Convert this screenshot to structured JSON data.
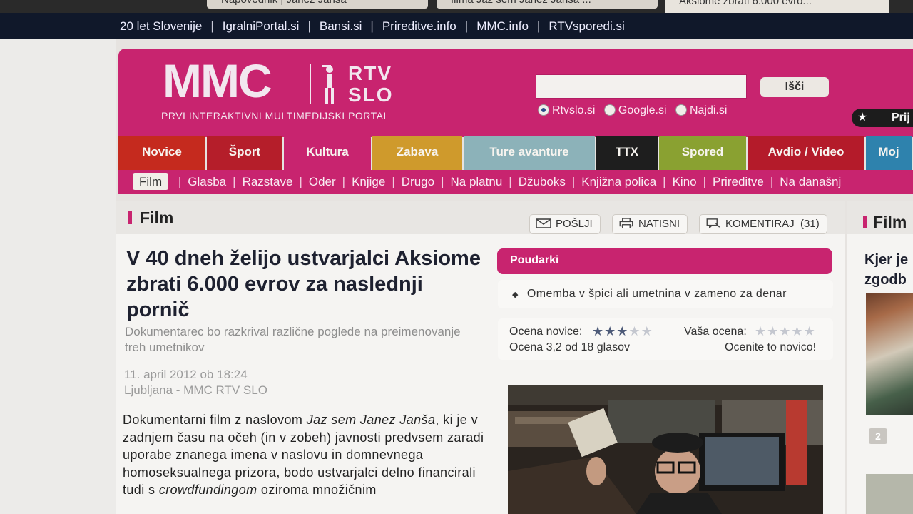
{
  "browser_tabs": [
    "Napovednik | Janez Janša",
    "filma Jaz sem Janez Janša ...",
    "Aksiome zbrati 6.000 evro..."
  ],
  "top_links": [
    "20 let Slovenije",
    "IgralniPortal.si",
    "Bansi.si",
    "Prireditve.info",
    "MMC.info",
    "RTVsporedi.si"
  ],
  "logo": {
    "mmc": "MMC",
    "rtv": "RTV",
    "slo": "SLO",
    "tagline": "PRVI INTERAKTIVNI MULTIMEDIJSKI PORTAL"
  },
  "search": {
    "value": "",
    "button": "Išči",
    "options": [
      "Rtvslo.si",
      "Google.si",
      "Najdi.si"
    ],
    "selected": "Rtvslo.si"
  },
  "login": {
    "label": "Prij"
  },
  "nav": [
    {
      "label": "Novice",
      "color": "#c52a1e"
    },
    {
      "label": "Šport",
      "color": "#b51e2a"
    },
    {
      "label": "Kultura",
      "color": "#c8246f"
    },
    {
      "label": "Zabava",
      "color": "#cf9a2c"
    },
    {
      "label": "Ture avanture",
      "color": "#8cb2b9"
    },
    {
      "label": "TTX",
      "color": "#1e1e1e"
    },
    {
      "label": "Spored",
      "color": "#8aa131"
    },
    {
      "label": "Avdio / Video",
      "color": "#b41b2a"
    },
    {
      "label": "Moj",
      "color": "#2e82ad"
    }
  ],
  "subnav": {
    "active": "Film",
    "items": [
      "Glasba",
      "Razstave",
      "Oder",
      "Knjige",
      "Drugo",
      "Na platnu",
      "Džuboks",
      "Knjižna polica",
      "Kino",
      "Prireditve",
      "Na današnj"
    ]
  },
  "section": {
    "title": "Film"
  },
  "actions": {
    "poslji": "POŠLJI",
    "natisni": "NATISNI",
    "komentiraj": "KOMENTIRAJ",
    "comment_count": "(31)"
  },
  "article": {
    "headline": "V 40 dneh želijo ustvarjalci Aksiome zbrati 6.000 evrov za naslednji pornič",
    "subtitle": "Dokumentarec bo razkrival različne poglede na preimenovanje treh umetnikov",
    "date": "11. april 2012 ob 18:24",
    "location": "Ljubljana - MMC RTV SLO",
    "body": {
      "p1": "Dokumentarni film z naslovom ",
      "em1": "Jaz sem Janez Janša",
      "p2": ", ki je v zadnjem času na očeh (in v zobeh) javnosti predvsem zaradi uporabe znanega imena v naslovu in domnevnega homoseksualnega prizora, bodo ustvarjalci delno financirali tudi s ",
      "em2": "crowdfundingom",
      "p3": " oziroma množičnim"
    }
  },
  "poudarki": {
    "title": "Poudarki",
    "item": "Omemba v špici ali umetnina v zameno za denar"
  },
  "rating": {
    "label": "Ocena novice:",
    "stars": 3,
    "max_stars": 5,
    "summary": "Ocena 3,2 od 18 glasov",
    "user_label": "Vaša ocena:",
    "user_stars": 0,
    "cta": "Ocenite to novico!"
  },
  "right_column": {
    "title": "Film",
    "text_line1": "Kjer je",
    "text_line2": "zgodb",
    "comment_badge": "2"
  }
}
